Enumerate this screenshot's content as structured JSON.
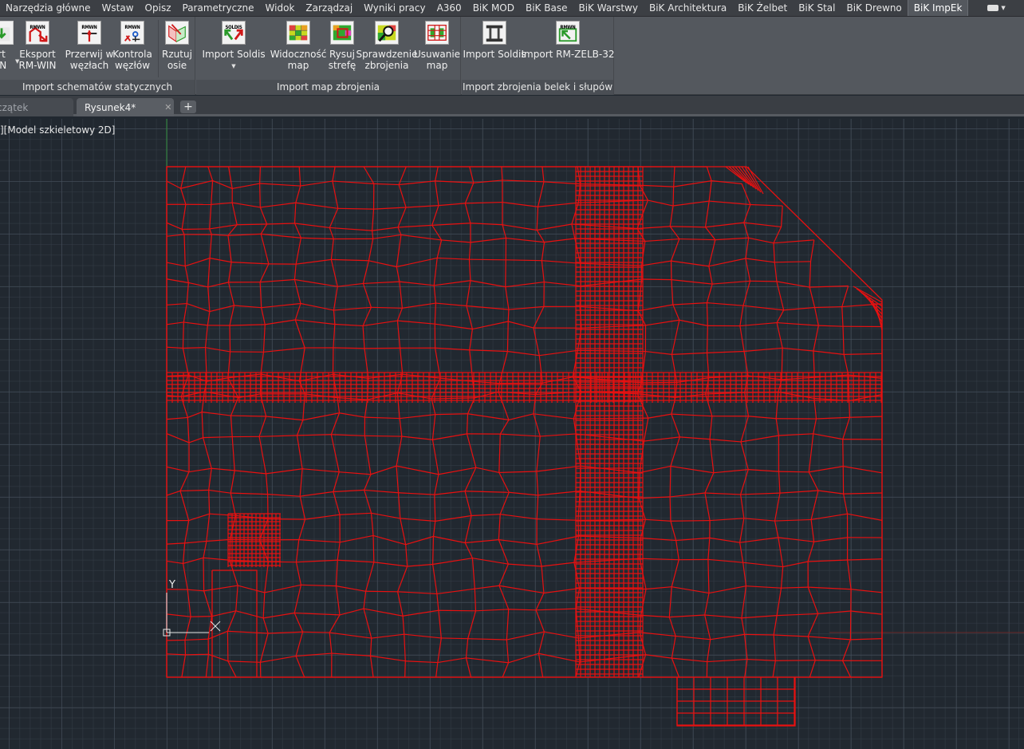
{
  "ribbon_tabs": [
    {
      "label": "Narzędzia główne"
    },
    {
      "label": "Wstaw"
    },
    {
      "label": "Opisz"
    },
    {
      "label": "Parametryczne"
    },
    {
      "label": "Widok"
    },
    {
      "label": "Zarządzaj"
    },
    {
      "label": "Wyniki pracy"
    },
    {
      "label": "A360"
    },
    {
      "label": "BiK MOD"
    },
    {
      "label": "BiK Base"
    },
    {
      "label": "BiK Warstwy"
    },
    {
      "label": "BiK Architektura"
    },
    {
      "label": "BiK Żelbet"
    },
    {
      "label": "BiK Stal"
    },
    {
      "label": "BiK Drewno"
    },
    {
      "label": "BiK ImpEk",
      "active": true
    }
  ],
  "panels": {
    "schematy": {
      "title": "Import schematów statycznych",
      "buttons": [
        {
          "line1": "rt",
          "line2": "IN",
          "icon_tag": ""
        },
        {
          "line1": "Eksport",
          "line2": "RM-WIN",
          "icon_tag": "RMWN"
        },
        {
          "line1": "Przerwij w",
          "line2": "węzłach",
          "icon_tag": "RMWN"
        },
        {
          "line1": "Kontrola",
          "line2": "węzłów",
          "icon_tag": "RMWN"
        },
        {
          "line1": "Rzutuj",
          "line2": "osie",
          "icon_tag": ""
        }
      ]
    },
    "mapy": {
      "title": "Import map zbrojenia",
      "buttons": [
        {
          "line1": "Import Soldis",
          "line2": "",
          "icon_tag": "SOLDIS"
        },
        {
          "line1": "Widoczność",
          "line2": "map",
          "icon_tag": ""
        },
        {
          "line1": "Rysuj",
          "line2": "strefę",
          "icon_tag": ""
        },
        {
          "line1": "Sprawdzenie",
          "line2": "zbrojenia",
          "icon_tag": ""
        },
        {
          "line1": "Usuwanie",
          "line2": "map",
          "icon_tag": ""
        }
      ]
    },
    "belki": {
      "title": "Import zbrojenia belek i słupów",
      "buttons": [
        {
          "line1": "Import Soldis",
          "line2": "",
          "icon_tag": ""
        },
        {
          "line1": "Import RM-ZELB-32",
          "line2": "",
          "icon_tag": "RMWN"
        }
      ]
    }
  },
  "doc_tabs": [
    {
      "label": "czątek"
    },
    {
      "label": "Rysunek4*",
      "active": true
    }
  ],
  "viewport_label": "][Model szkieletowy 2D]",
  "ucs": {
    "y_label": "Y"
  },
  "colors": {
    "mesh": "#e81010",
    "canvas": "#212830",
    "ribbon": "#54585e"
  }
}
